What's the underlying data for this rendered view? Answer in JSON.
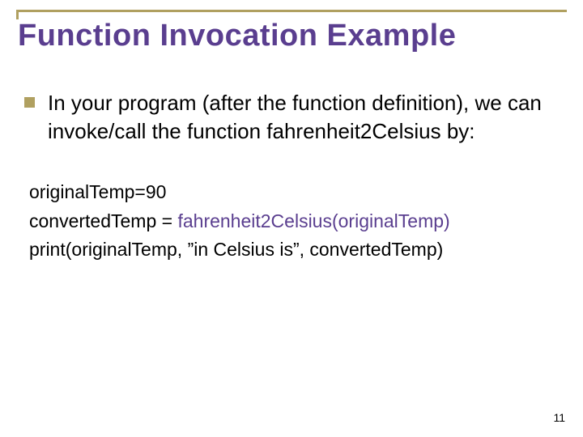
{
  "title": "Function Invocation Example",
  "bullet": "In your program (after the function definition), we can invoke/call the function fahrenheit2Celsius by:",
  "code": {
    "l1": "originalTemp=90",
    "l2a": "convertedTemp = ",
    "l2b": "fahrenheit2Celsius(originalTemp)",
    "l3": "print(originalTemp, ”in Celsius is”, convertedTemp)"
  },
  "page": "11"
}
